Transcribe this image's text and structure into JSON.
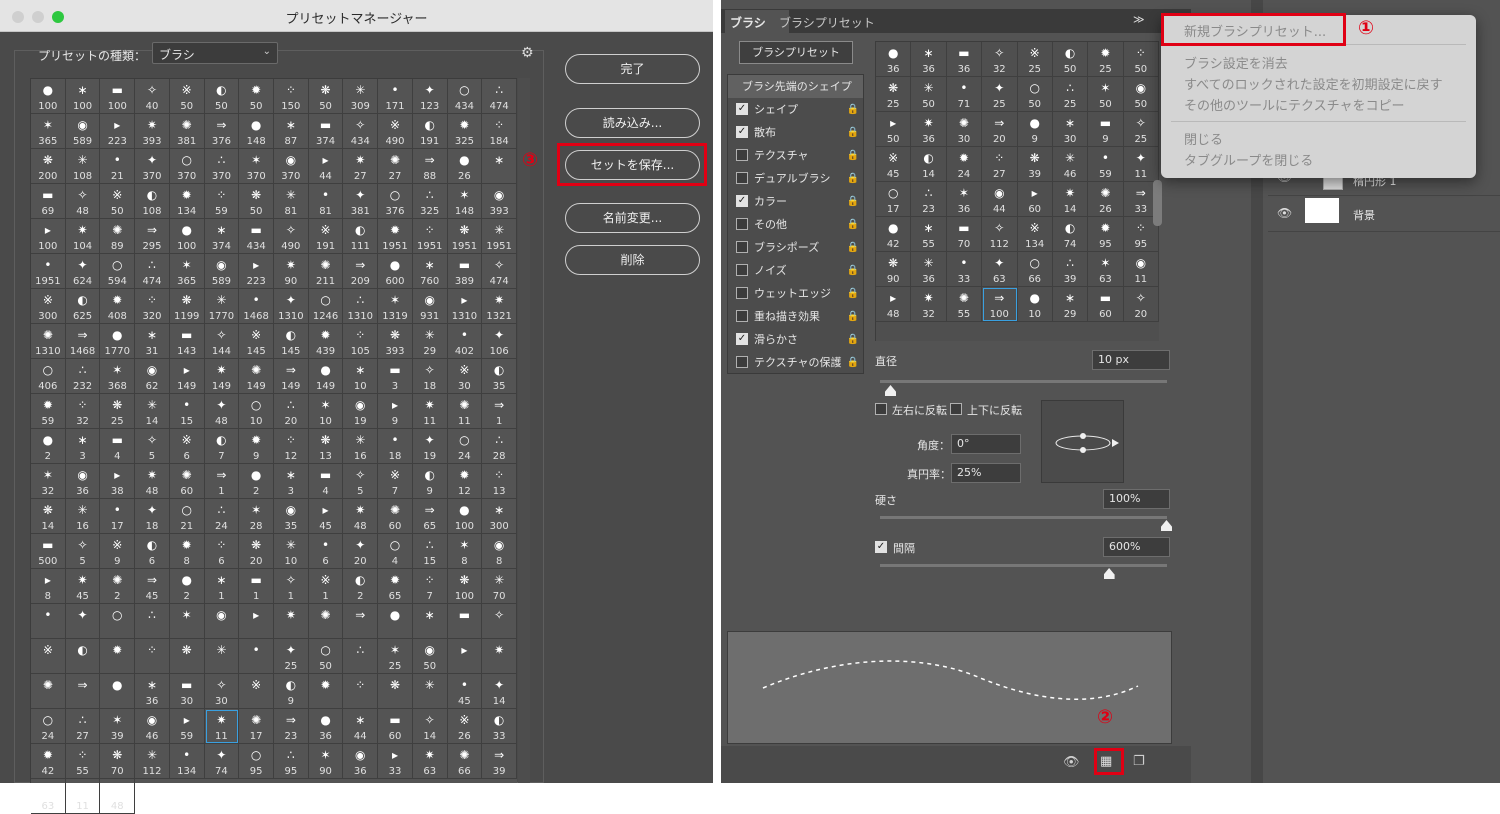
{
  "preset_manager": {
    "title": "プリセットマネージャー",
    "type_label": "プリセットの種類：",
    "type_value": "ブラシ",
    "buttons": {
      "done": "完了",
      "load": "読み込み...",
      "save_set": "セットを保存...",
      "rename": "名前変更...",
      "delete": "削除"
    }
  },
  "preset_sizes": [
    "100",
    "100",
    "100",
    "40",
    "50",
    "50",
    "50",
    "150",
    "50",
    "309",
    "171",
    "123",
    "434",
    "474",
    "365",
    "589",
    "223",
    "393",
    "381",
    "376",
    "148",
    "87",
    "374",
    "434",
    "490",
    "191",
    "325",
    "184",
    "200",
    "108",
    "21",
    "370",
    "370",
    "370",
    "370",
    "370",
    "44",
    "27",
    "27",
    "88",
    "26",
    "",
    "69",
    "48",
    "50",
    "108",
    "134",
    "59",
    "50",
    "81",
    "81",
    "381",
    "376",
    "325",
    "148",
    "393",
    "100",
    "104",
    "89",
    "295",
    "100",
    "374",
    "434",
    "490",
    "191",
    "111",
    "1951",
    "1951",
    "1951",
    "1951",
    "1951",
    "624",
    "594",
    "474",
    "365",
    "589",
    "223",
    "90",
    "211",
    "209",
    "600",
    "760",
    "389",
    "474",
    "300",
    "625",
    "408",
    "320",
    "1199",
    "1770",
    "1468",
    "1310",
    "1246",
    "1310",
    "1319",
    "931",
    "1310",
    "1321",
    "1310",
    "1468",
    "1770",
    "31",
    "143",
    "144",
    "145",
    "145",
    "439",
    "105",
    "393",
    "29",
    "402",
    "106",
    "406",
    "232",
    "368",
    "62",
    "149",
    "149",
    "149",
    "149",
    "149",
    "10",
    "3",
    "18",
    "30",
    "35",
    "59",
    "32",
    "25",
    "14",
    "15",
    "48",
    "10",
    "20",
    "10",
    "19",
    "9",
    "11",
    "11",
    "1",
    "2",
    "3",
    "4",
    "5",
    "6",
    "7",
    "9",
    "12",
    "13",
    "16",
    "18",
    "19",
    "24",
    "28",
    "32",
    "36",
    "38",
    "48",
    "60",
    "1",
    "2",
    "3",
    "4",
    "5",
    "7",
    "9",
    "12",
    "13",
    "14",
    "16",
    "17",
    "18",
    "21",
    "24",
    "28",
    "35",
    "45",
    "48",
    "60",
    "65",
    "100",
    "300",
    "500",
    "5",
    "9",
    "6",
    "8",
    "6",
    "20",
    "10",
    "6",
    "20",
    "4",
    "15",
    "8",
    "8",
    "8",
    "45",
    "2",
    "45",
    "2",
    "1",
    "1",
    "1",
    "1",
    "2",
    "65",
    "7",
    "100",
    "70",
    "",
    "",
    "",
    "",
    "",
    "",
    "",
    "",
    "",
    "",
    "",
    "",
    "",
    "",
    "",
    "",
    "",
    "",
    "",
    "",
    "",
    "25",
    "50",
    "",
    "25",
    "50",
    "",
    "",
    "",
    "",
    "",
    "36",
    "30",
    "30",
    "",
    "9",
    "",
    "",
    "",
    "",
    "45",
    "14",
    "24",
    "27",
    "39",
    "46",
    "59",
    "11",
    "17",
    "23",
    "36",
    "44",
    "60",
    "14",
    "26",
    "33",
    "42",
    "55",
    "70",
    "112",
    "134",
    "74",
    "95",
    "95",
    "90",
    "36",
    "33",
    "63",
    "66",
    "39",
    "63",
    "11",
    "48"
  ],
  "brush_panel": {
    "tab_brush": "ブラシ",
    "tab_brush_presets": "ブラシプリセット",
    "brush_presets_button": "ブラシプリセット",
    "panel_menu_icon": "≫",
    "options": [
      {
        "label": "ブラシ先端のシェイプ",
        "head": true
      },
      {
        "label": "シェイプ",
        "checked": true
      },
      {
        "label": "散布",
        "checked": true
      },
      {
        "label": "テクスチャ",
        "checked": false
      },
      {
        "label": "デュアルブラシ",
        "checked": false
      },
      {
        "label": "カラー",
        "checked": true
      },
      {
        "label": "その他",
        "checked": false
      },
      {
        "label": "ブラシポーズ",
        "checked": false
      },
      {
        "label": "ノイズ",
        "checked": false
      },
      {
        "label": "ウェットエッジ",
        "checked": false
      },
      {
        "label": "重ね描き効果",
        "checked": false
      },
      {
        "label": "滑らかさ",
        "checked": true
      },
      {
        "label": "テクスチャの保護",
        "checked": false
      }
    ],
    "brush_sizes": [
      "36",
      "36",
      "36",
      "32",
      "25",
      "50",
      "25",
      "50",
      "25",
      "50",
      "71",
      "25",
      "50",
      "25",
      "50",
      "50",
      "50",
      "36",
      "30",
      "20",
      "9",
      "30",
      "9",
      "25",
      "45",
      "14",
      "24",
      "27",
      "39",
      "46",
      "59",
      "11",
      "17",
      "23",
      "36",
      "44",
      "60",
      "14",
      "26",
      "33",
      "42",
      "55",
      "70",
      "112",
      "134",
      "74",
      "95",
      "95",
      "90",
      "36",
      "33",
      "63",
      "66",
      "39",
      "63",
      "11",
      "48",
      "32",
      "55",
      "100",
      "10",
      "29",
      "60",
      "20"
    ],
    "diameter_label": "直径",
    "diameter_value": "10 px",
    "flip_x": "左右に反転",
    "flip_y": "上下に反転",
    "angle_label": "角度：",
    "angle_value": "0°",
    "roundness_label": "真円率：",
    "roundness_value": "25%",
    "hardness_label": "硬さ",
    "hardness_value": "100%",
    "spacing_label": "間隔",
    "spacing_value": "600%",
    "hardness_level": 1.0,
    "spacing_level": 0.8
  },
  "layers": [
    {
      "name": "楕円形 1"
    },
    {
      "name": "背景"
    }
  ],
  "menu": {
    "items_group1": [
      "新規ブラシプリセット..."
    ],
    "items_group2": [
      "ブラシ設定を消去",
      "すべてのロックされた設定を初期設定に戻す",
      "その他のツールにテクスチャをコピー"
    ],
    "items_group3": [
      "閉じる",
      "タブグループを閉じる"
    ]
  },
  "annotations": {
    "one": "①",
    "two": "②",
    "three": "③"
  },
  "colors": {
    "highlight": "#e00014",
    "selection": "#3aa0e0"
  }
}
